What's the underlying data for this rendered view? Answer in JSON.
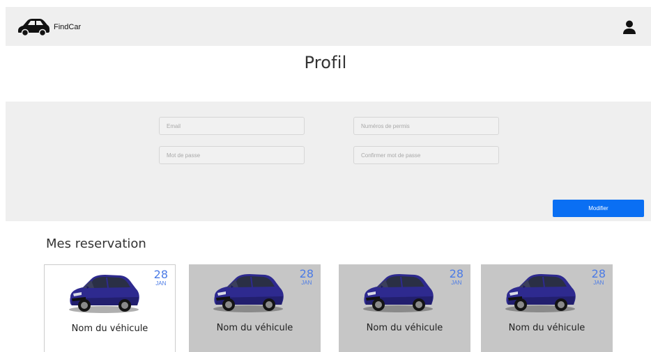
{
  "header": {
    "brand": "FindCar",
    "logo_icon": "car-icon",
    "user_icon": "user-icon"
  },
  "page": {
    "title": "Profil"
  },
  "form": {
    "email_placeholder": "Email",
    "permis_placeholder": "Numéros de permis",
    "password_placeholder": "Mot de passe",
    "confirm_placeholder": "Confirmer mot de passe",
    "modify_label": "Modifier"
  },
  "reservations": {
    "title": "Mes reservation",
    "items": [
      {
        "name": "Nom du véhicule",
        "day": "28",
        "month": "JAN"
      },
      {
        "name": "Nom du véhicule",
        "day": "28",
        "month": "JAN"
      },
      {
        "name": "Nom du véhicule",
        "day": "28",
        "month": "JAN"
      },
      {
        "name": "Nom du véhicule",
        "day": "28",
        "month": "JAN"
      }
    ]
  },
  "colors": {
    "header_bg": "#efefef",
    "panel_bg": "#efefef",
    "primary": "#0a6ff3",
    "card_bg": "#c6c6c6",
    "date_accent": "#4b7be6",
    "car_body": "#2e2a8f"
  }
}
